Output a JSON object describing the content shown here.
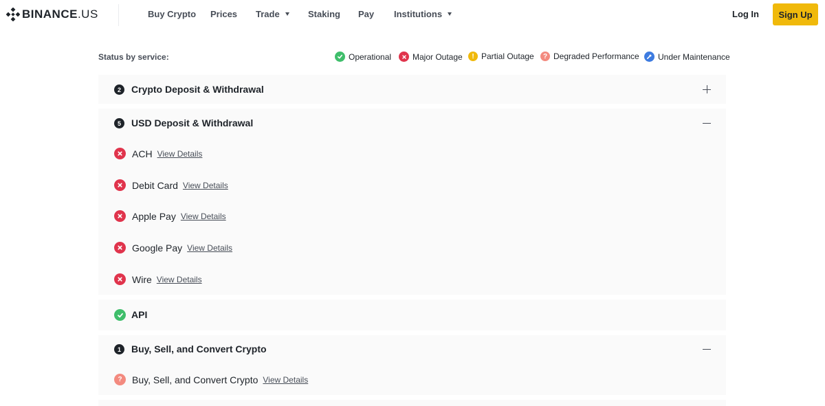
{
  "header": {
    "logo_text": "BINANCE",
    "logo_suffix": ".US",
    "nav": [
      "Buy Crypto",
      "Prices",
      "Trade",
      "Staking",
      "Pay",
      "Institutions"
    ],
    "login_label": "Log In",
    "signup_label": "Sign Up",
    "brand_color": "#f0b90b"
  },
  "status": {
    "label": "Status by service:",
    "legend": {
      "operational": "Operational",
      "major_outage": "Major Outage",
      "partial_outage": "Partial Outage",
      "degraded_performance": "Degraded Performance",
      "under_maintenance": "Under Maintenance"
    },
    "colors": {
      "operational": "#3fbe6b",
      "major_outage": "#e0344c",
      "partial_outage": "#f0b90b",
      "degraded_performance": "#f38a7f",
      "under_maintenance": "#3d7be0"
    }
  },
  "sections": {
    "crypto": {
      "count": "2",
      "title": "Crypto Deposit & Withdrawal"
    },
    "usd": {
      "count": "5",
      "title": "USD Deposit & Withdrawal",
      "items": [
        {
          "name": "ACH",
          "link": "View Details",
          "status": "major-outage"
        },
        {
          "name": "Debit Card",
          "link": "View Details",
          "status": "major-outage"
        },
        {
          "name": "Apple Pay",
          "link": "View Details",
          "status": "major-outage"
        },
        {
          "name": "Google Pay",
          "link": "View Details",
          "status": "major-outage"
        },
        {
          "name": "Wire",
          "link": "View Details",
          "status": "major-outage"
        }
      ]
    },
    "api": {
      "title": "API",
      "status": "operational"
    },
    "buy_sell": {
      "count": "1",
      "title": "Buy, Sell, and Convert Crypto",
      "items": [
        {
          "name": "Buy, Sell, and Convert Crypto",
          "link": "View Details",
          "status": "degraded-performance"
        }
      ]
    }
  }
}
